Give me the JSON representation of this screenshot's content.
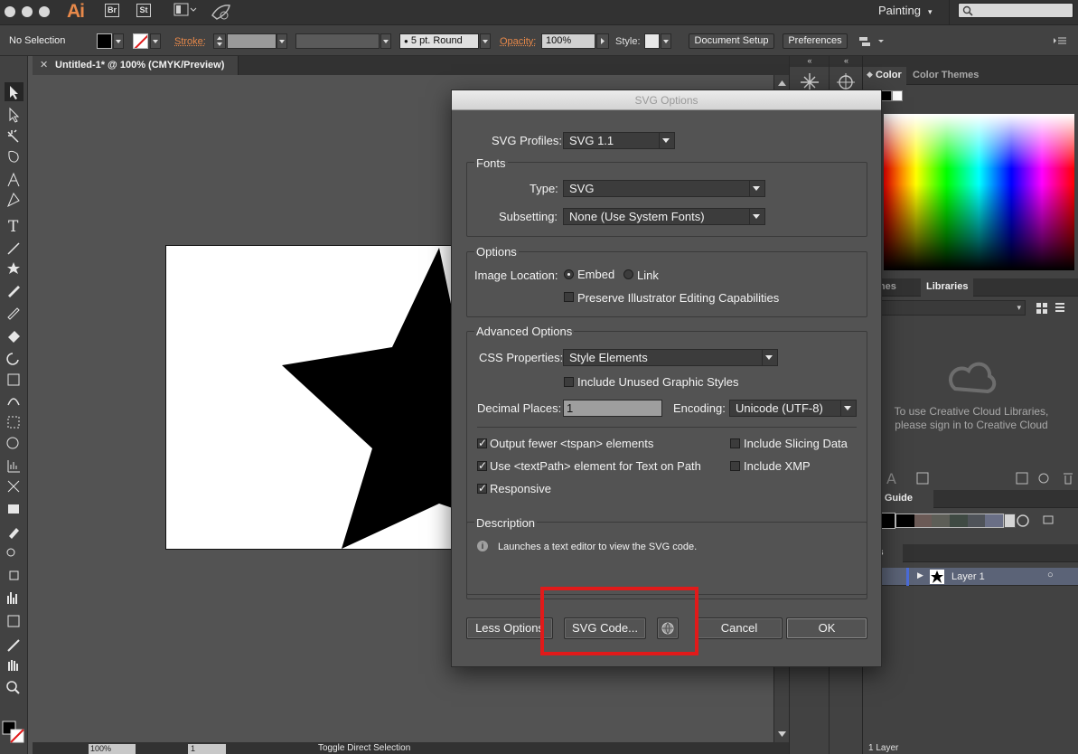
{
  "app": {
    "logo": "Ai",
    "app_chips": [
      "Br",
      "St"
    ],
    "workspace": "Painting"
  },
  "control_bar": {
    "selection_status": "No Selection",
    "stroke_label": "Stroke:",
    "brush_size": "5 pt. Round",
    "opacity_label": "Opacity:",
    "opacity_value": "100%",
    "style_label": "Style:",
    "document_setup": "Document Setup",
    "preferences": "Preferences"
  },
  "document_tab": {
    "close": "✕",
    "title": "Untitled-1* @ 100% (CMYK/Preview)"
  },
  "status_bar": {
    "zoom": "100%",
    "page": "1",
    "tool_status": "Toggle Direct Selection"
  },
  "panels": {
    "color_tabs": [
      "Color",
      "Color Themes"
    ],
    "swatch_tabs": [
      "atches",
      "Libraries"
    ],
    "libraries_message": "To use Creative Cloud Libraries, please sign in to Creative Cloud",
    "color_guide_tab": "olor Guide",
    "layers_tab": "yers",
    "layer_name": "Layer 1",
    "layers_count": "1 Layer",
    "guide_swatches": [
      "#000000",
      "#6b5a56",
      "#5d5e57",
      "#3f4a43",
      "#4f5359",
      "#6a6f86"
    ]
  },
  "dialog": {
    "title": "SVG Options",
    "svg_profiles_label": "SVG Profiles:",
    "svg_profiles_value": "SVG 1.1",
    "fonts": {
      "title": "Fonts",
      "type_label": "Type:",
      "type_value": "SVG",
      "subsetting_label": "Subsetting:",
      "subsetting_value": "None (Use System Fonts)"
    },
    "options": {
      "title": "Options",
      "image_location_label": "Image Location:",
      "embed": "Embed",
      "link": "Link",
      "preserve": "Preserve Illustrator Editing Capabilities"
    },
    "advanced": {
      "title": "Advanced Options",
      "css_label": "CSS Properties:",
      "css_value": "Style Elements",
      "unused_styles": "Include Unused Graphic Styles",
      "decimal_label": "Decimal Places:",
      "decimal_value": "1",
      "encoding_label": "Encoding:",
      "encoding_value": "Unicode (UTF-8)",
      "fewer_tspan": "Output fewer <tspan> elements",
      "slicing": "Include Slicing Data",
      "textpath": "Use <textPath> element for Text on Path",
      "xmp": "Include XMP",
      "responsive": "Responsive"
    },
    "description": {
      "title": "Description",
      "icon": "i",
      "text": "Launches a text editor to view the SVG code."
    },
    "buttons": {
      "less_options": "Less Options",
      "svg_code": "SVG Code...",
      "cancel": "Cancel",
      "ok": "OK"
    }
  },
  "colors": {
    "accent_orange": "#e8894a",
    "annotation_red": "#e11a1a"
  }
}
